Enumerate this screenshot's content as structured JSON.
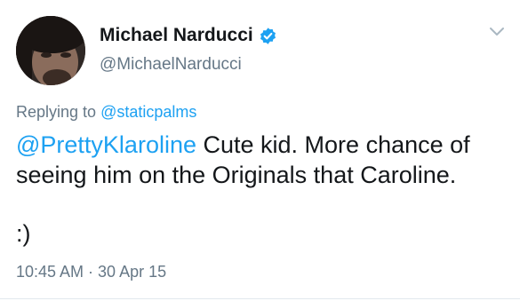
{
  "author": {
    "display_name": "Michael Narducci",
    "handle": "@MichaelNarducci",
    "verified": true,
    "avatar_icon": "profile-photo"
  },
  "reply_context": {
    "prefix": "Replying to",
    "mention": "@staticpalms"
  },
  "tweet": {
    "mention": "@PrettyKlaroline",
    "text": " Cute kid. More chance of seeing him on the Originals that Caroline.",
    "emoticon": ":)"
  },
  "meta": {
    "timestamp": "10:45 AM · 30 Apr 15"
  },
  "icons": {
    "verified": "verified-badge-icon",
    "menu": "chevron-down-icon"
  },
  "colors": {
    "link": "#1da1f2",
    "secondary_text": "#657786",
    "primary_text": "#14171a"
  }
}
